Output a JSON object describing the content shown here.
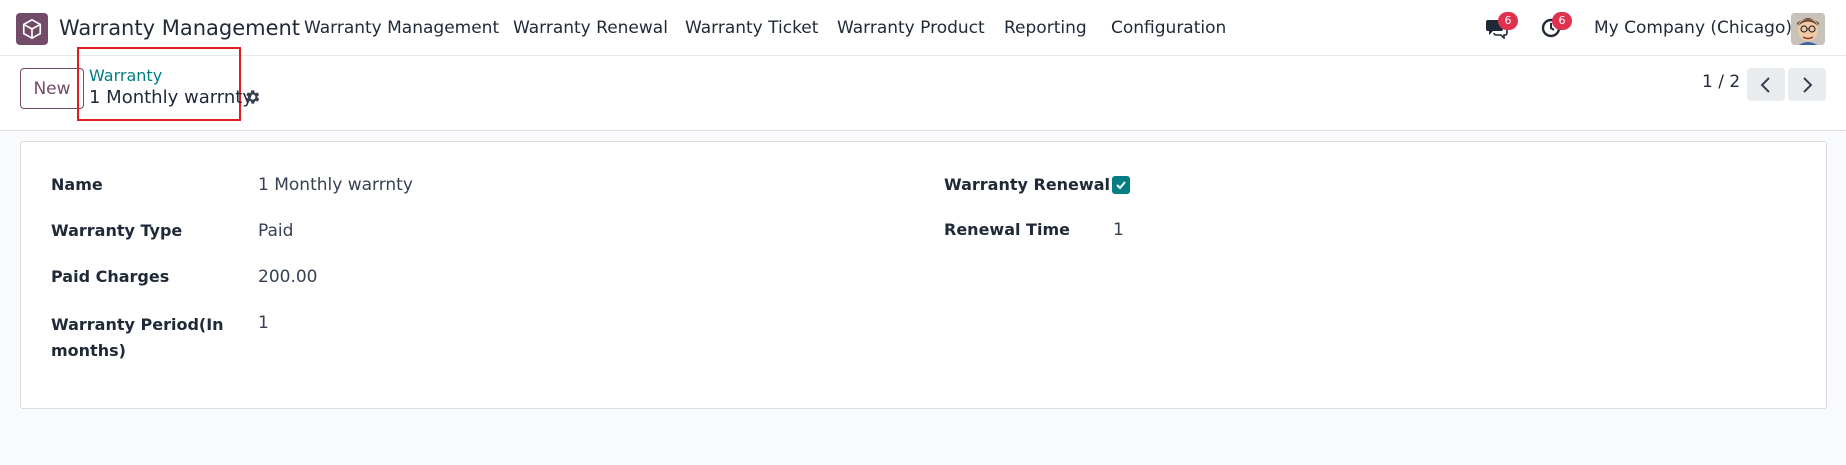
{
  "navbar": {
    "app_name": "Warranty Management",
    "menu": [
      "Warranty Management",
      "Warranty Renewal",
      "Warranty Ticket",
      "Warranty Product",
      "Reporting",
      "Configuration"
    ],
    "messages_badge": "6",
    "activities_badge": "6",
    "company": "My Company (Chicago)"
  },
  "control": {
    "new_label": "New",
    "breadcrumb_parent": "Warranty",
    "breadcrumb_current": "1 Monthly warrnty",
    "pager": "1 / 2"
  },
  "form": {
    "left": [
      {
        "label": "Name",
        "value": "1 Monthly warrnty"
      },
      {
        "label": "Warranty Type",
        "value": "Paid"
      },
      {
        "label": "Paid Charges",
        "value": "200.00"
      },
      {
        "label": "Warranty Period(In months)",
        "value": "1"
      }
    ],
    "right": [
      {
        "label": "Warranty Renewal",
        "checked": true
      },
      {
        "label": "Renewal Time",
        "value": "1"
      }
    ]
  },
  "colors": {
    "brand": "#714b67",
    "accent": "#017e84",
    "badge": "#e0324f",
    "highlight_box": "#e11d2a"
  }
}
